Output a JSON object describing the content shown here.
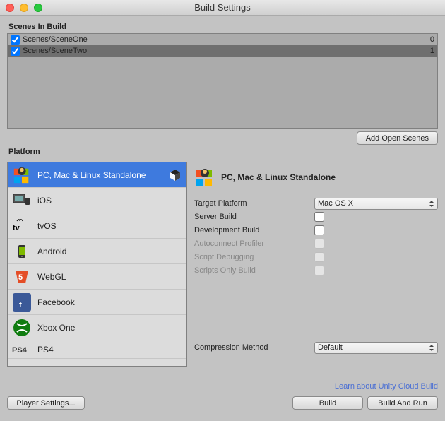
{
  "window": {
    "title": "Build Settings"
  },
  "scenes": {
    "label": "Scenes In Build",
    "items": [
      {
        "name": "Scenes/SceneOne",
        "checked": true,
        "index": 0,
        "selected": false
      },
      {
        "name": "Scenes/SceneTwo",
        "checked": true,
        "index": 1,
        "selected": true
      }
    ],
    "add_button": "Add Open Scenes"
  },
  "platform": {
    "label": "Platform",
    "items": [
      {
        "name": "PC, Mac & Linux Standalone",
        "icon": "pc-icon",
        "selected": true,
        "current": true
      },
      {
        "name": "iOS",
        "icon": "ios-icon"
      },
      {
        "name": "tvOS",
        "icon": "tvos-icon"
      },
      {
        "name": "Android",
        "icon": "android-icon"
      },
      {
        "name": "WebGL",
        "icon": "webgl-icon"
      },
      {
        "name": "Facebook",
        "icon": "facebook-icon"
      },
      {
        "name": "Xbox One",
        "icon": "xbox-icon"
      },
      {
        "name": "PS4",
        "icon": "ps4-icon",
        "short": true
      }
    ]
  },
  "build_options": {
    "title": "PC, Mac & Linux Standalone",
    "rows": [
      {
        "label": "Target Platform",
        "type": "select",
        "value": "Mac OS X"
      },
      {
        "label": "Server Build",
        "type": "check",
        "value": false
      },
      {
        "label": "Development Build",
        "type": "check",
        "value": false
      },
      {
        "label": "Autoconnect Profiler",
        "type": "check",
        "value": false,
        "disabled": true
      },
      {
        "label": "Script Debugging",
        "type": "check",
        "value": false,
        "disabled": true
      },
      {
        "label": "Scripts Only Build",
        "type": "check",
        "value": false,
        "disabled": true
      }
    ],
    "compression": {
      "label": "Compression Method",
      "value": "Default"
    },
    "link": "Learn about Unity Cloud Build"
  },
  "footer": {
    "player_settings": "Player Settings...",
    "build": "Build",
    "build_and_run": "Build And Run"
  }
}
